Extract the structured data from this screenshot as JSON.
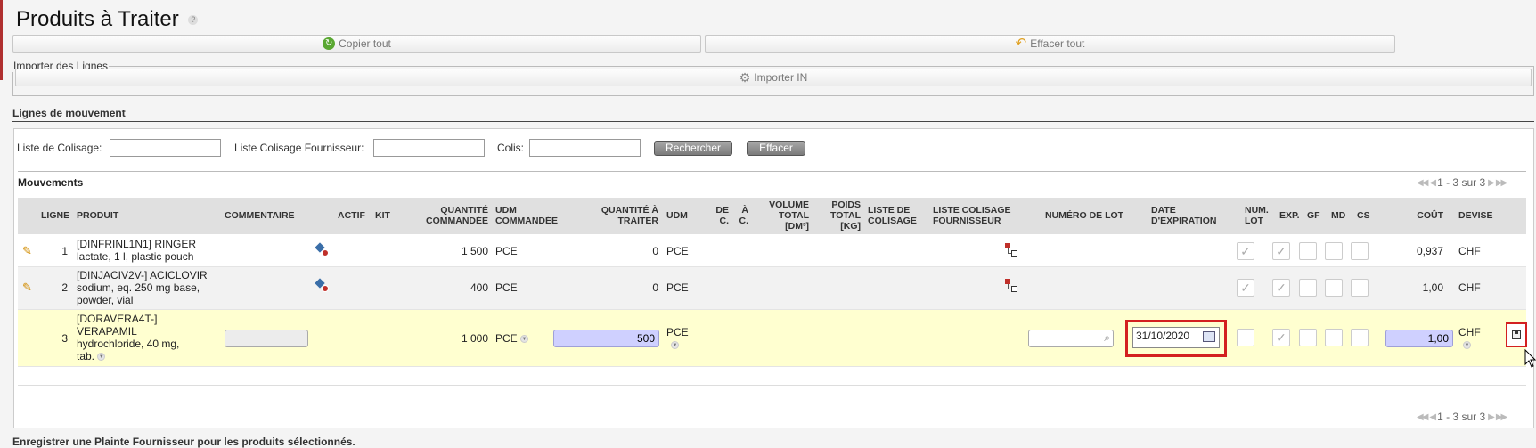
{
  "page": {
    "title": "Produits à Traiter",
    "help_glyph": "?"
  },
  "toolbar": {
    "copy_all": "Copier tout",
    "clear_all": "Effacer tout"
  },
  "import": {
    "legend": "Importer des Lignes",
    "import_in": "Importer IN"
  },
  "section": {
    "title": "Lignes de mouvement"
  },
  "filters": {
    "packing_list_label": "Liste de Colisage:",
    "packing_list_value": "",
    "supplier_packing_label": "Liste Colisage Fournisseur:",
    "supplier_packing_value": "",
    "parcel_label": "Colis:",
    "parcel_value": "",
    "search_button": "Rechercher",
    "clear_button": "Effacer"
  },
  "grid": {
    "title": "Mouvements",
    "pager_text": "1 - 3 sur 3",
    "headers": {
      "ligne": "Ligne",
      "produit": "Produit",
      "commentaire": "Commentaire",
      "actif": "Actif",
      "kit": "Kit",
      "qty_ordered_1": "Quantité",
      "qty_ordered_2": "Commandée",
      "udm_ordered_1": "UDM",
      "udm_ordered_2": "Commandée",
      "qty_to_process_1": "Quantité à",
      "qty_to_process_2": "Traiter",
      "udm": "UDM",
      "de_1": "De",
      "de_2": "C.",
      "a_1": "À",
      "a_2": "C.",
      "vol_1": "Volume",
      "vol_2": "Total",
      "vol_3": "[DM³]",
      "poids_1": "Poids",
      "poids_2": "Total",
      "poids_3": "[KG]",
      "liste_col_1": "Liste de",
      "liste_col_2": "Colisage",
      "liste_four_1": "Liste Colisage",
      "liste_four_2": "Fournisseur",
      "num_lot": "Numéro de Lot",
      "date_exp_1": "Date",
      "date_exp_2": "d'Expiration",
      "num_lot_short_1": "Num.",
      "num_lot_short_2": "Lot",
      "exp": "Exp.",
      "gf": "GF",
      "md": "MD",
      "cs": "CS",
      "cout": "Coût",
      "devise": "Devise"
    },
    "rows": [
      {
        "ligne": "1",
        "produit_1": "[DINFRINL1N1] RINGER",
        "produit_2": "lactate, 1 l, plastic pouch",
        "qty_ordered": "1 500",
        "udm_ordered": "PCE",
        "qty_to_process": "0",
        "udm": "PCE",
        "cout": "0,937",
        "devise": "CHF"
      },
      {
        "ligne": "2",
        "produit_1": "[DINJACIV2V-] ACICLOVIR",
        "produit_2": "sodium, eq. 250 mg base,",
        "produit_3": "powder, vial",
        "qty_ordered": "400",
        "udm_ordered": "PCE",
        "qty_to_process": "0",
        "udm": "PCE",
        "cout": "1,00",
        "devise": "CHF"
      },
      {
        "ligne": "3",
        "produit_1": "[DORAVERA4T-]",
        "produit_2": "VERAPAMIL",
        "produit_3": "hydrochloride, 40 mg,",
        "produit_4": "tab.",
        "qty_ordered": "1 000",
        "udm_ordered": "PCE",
        "qty_to_process": "500",
        "udm": "PCE",
        "date_exp": "31/10/2020",
        "cout": "1,00",
        "devise": "CHF"
      }
    ]
  },
  "bottom": {
    "text": "Enregistrer une Plainte Fournisseur pour les produits sélectionnés."
  },
  "colors": {
    "editing_row": "#ffffd0",
    "highlight": "#d32020",
    "input_blue": "#cfd0ff"
  }
}
